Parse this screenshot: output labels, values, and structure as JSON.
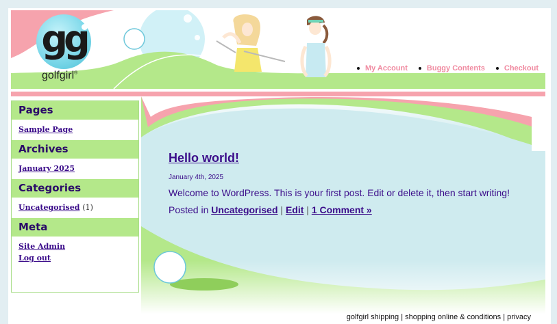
{
  "brand": {
    "logo_letters": "gg",
    "wordmark": "golfgirl",
    "trademark": "®"
  },
  "nav": {
    "items": [
      {
        "label": "My Account"
      },
      {
        "label": "Buggy Contents"
      },
      {
        "label": "Checkout"
      }
    ]
  },
  "sidebar": {
    "pages": {
      "title": "Pages",
      "links": [
        "Sample Page"
      ]
    },
    "archives": {
      "title": "Archives",
      "links": [
        "January 2025"
      ]
    },
    "categories": {
      "title": "Categories",
      "link": "Uncategorised",
      "count": "(1)"
    },
    "meta": {
      "title": "Meta",
      "links": [
        "Site Admin",
        "Log out"
      ]
    }
  },
  "post": {
    "title": "Hello world!",
    "date": "January 4th, 2025",
    "body": "Welcome to WordPress. This is your first post. Edit or delete it, then start writing!",
    "posted_in": "Posted in",
    "category": "Uncategorised",
    "sep": "|",
    "edit": "Edit",
    "comments": "1 Comment »"
  },
  "footer": {
    "shipping": "golfgirl shipping",
    "sep": "|",
    "conditions": "shopping online & conditions",
    "privacy": "privacy"
  },
  "colors": {
    "accent_green": "#b4e88a",
    "accent_pink": "#f6a3ad",
    "link_purple": "#3b0c8a",
    "nav_pink": "#f08aa0",
    "main_bg": "#cfebef"
  }
}
